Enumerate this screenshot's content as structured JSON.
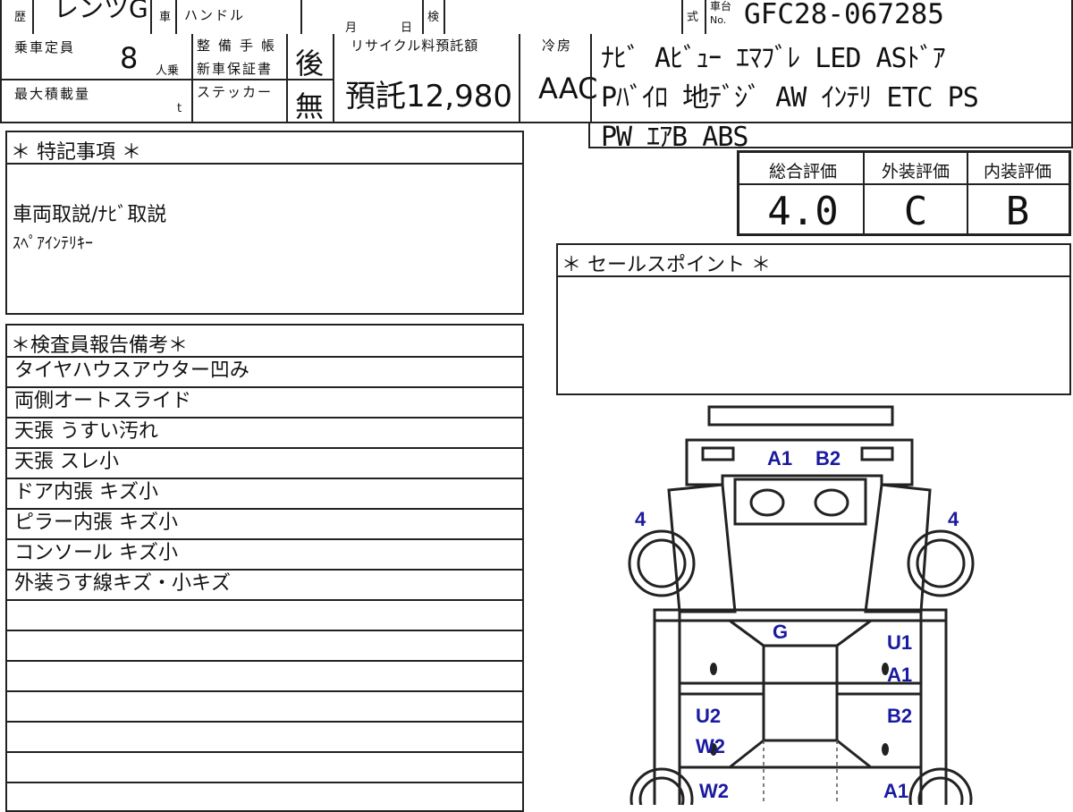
{
  "header": {
    "history_label": "歴",
    "model_cut": "レンツG",
    "car_label": "車",
    "handle_label": "ハンドル",
    "month_label": "月",
    "day_label": "日",
    "inspection_label": "検",
    "type_label": "式",
    "chassis_label_top": "車台",
    "chassis_label_bottom": "No.",
    "chassis_number": "GFC28-067285"
  },
  "specs": {
    "capacity_label": "乗車定員",
    "capacity_value": "8",
    "capacity_unit": "人乗",
    "max_load_label": "最大積載量",
    "max_load_unit": "t",
    "maintenance_label": "整備手帳",
    "warranty_label": "新車保証書",
    "maintenance_value": "後",
    "sticker_label": "ステッカー",
    "sticker_value": "無",
    "recycle_label": "リサイクル料預託額",
    "recycle_value": "預託12,980",
    "aircon_label": "冷房",
    "aircon_value": "AAC",
    "equipment": [
      "ﾅﾋﾞ Aﾋﾞｭｰ ｴﾏﾌﾞﾚ LED ASﾄﾞｱ",
      "Pﾊﾞｲﾛ 地ﾃﾞｼﾞ AW ｲﾝﾃﾘ ETC PS",
      "PW ｴｱB ABS"
    ]
  },
  "grades": {
    "overall_label": "総合評価",
    "overall_value": "4.0",
    "exterior_label": "外装評価",
    "exterior_value": "C",
    "interior_label": "内装評価",
    "interior_value": "B"
  },
  "special_notes": {
    "title": "＊ 特記事項 ＊",
    "lines": [
      "車両取説/ﾅﾋﾞ取説",
      "ｽﾍﾟｱｲﾝﾃﾘｷｰ"
    ]
  },
  "sales_point": {
    "title": "＊ セールスポイント ＊"
  },
  "inspector_notes": {
    "title": "＊検査員報告備考＊",
    "items": [
      "タイヤハウスアウター凹み",
      "両側オートスライド",
      "天張 うすい汚れ",
      "天張 スレ小",
      "ドア内張 キズ小",
      "ピラー内張 キズ小",
      "コンソール キズ小",
      "外装うす線キズ・小キズ"
    ]
  },
  "damage_map": {
    "label_front_left": "A1",
    "label_front_right": "B2",
    "label_wheel_left": "4",
    "label_wheel_right": "4",
    "label_glass": "G",
    "label_right_1": "U1",
    "label_right_2": "A1",
    "label_right_3": "B2",
    "label_left_1": "U2",
    "label_left_2": "W2",
    "label_left_3": "W2",
    "label_right_4": "A1",
    "ink_color": "#1a1aa0"
  }
}
